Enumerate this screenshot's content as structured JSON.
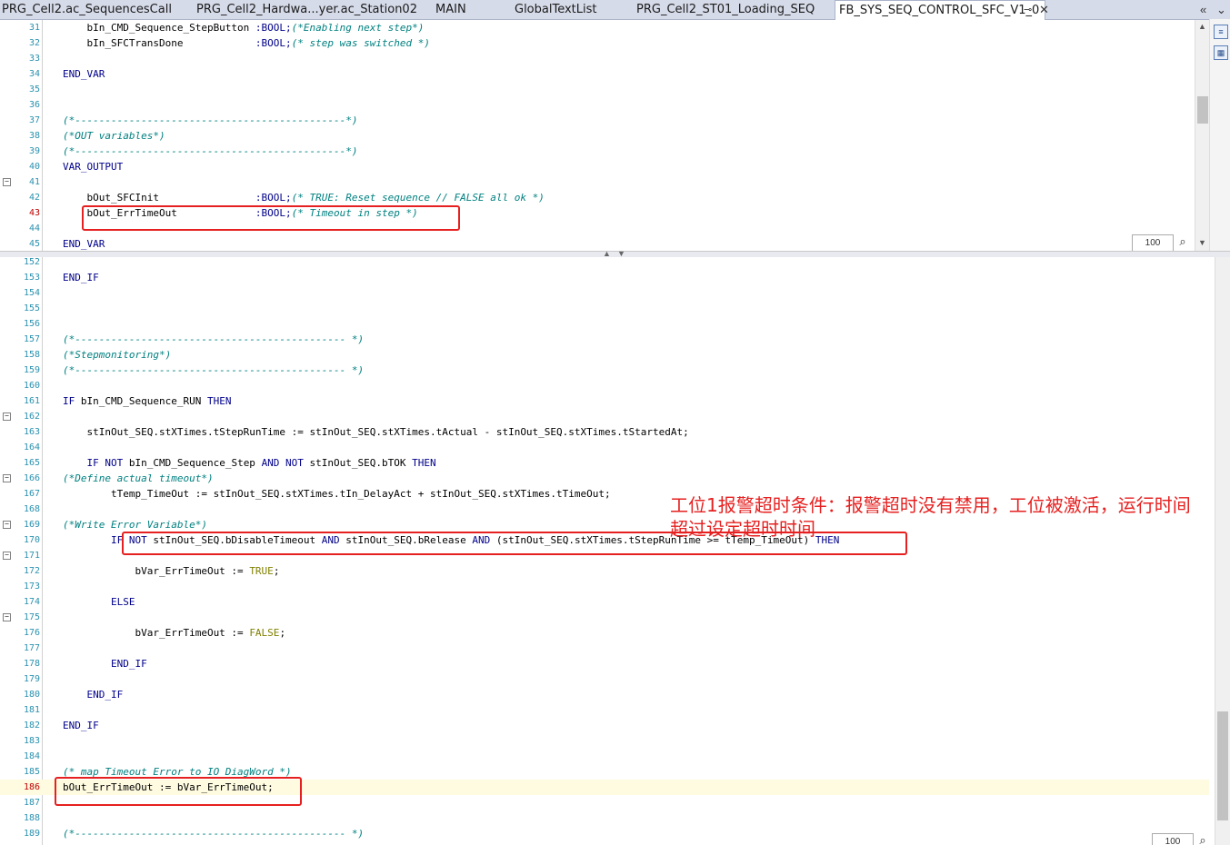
{
  "tabs": [
    {
      "label": "PRG_Cell2.ac_SequencesCall",
      "active": false
    },
    {
      "label": "PRG_Cell2_Hardwa...yer.ac_Station02",
      "active": false
    },
    {
      "label": "MAIN",
      "active": false
    },
    {
      "label": "GlobalTextList",
      "active": false
    },
    {
      "label": "PRG_Cell2_ST01_Loading_SEQ",
      "active": false
    },
    {
      "label": "FB_SYS_SEQ_CONTROL_SFC_V1_0",
      "active": true
    }
  ],
  "tab_controls": {
    "pin": "⊸",
    "close": "✕",
    "scroll_left": "«",
    "scroll_right": "⌄"
  },
  "top_pane": {
    "zoom": "100",
    "lines": [
      {
        "n": "31",
        "segs": [
          [
            "",
            "    bIn_CMD_Sequence_StepButton "
          ],
          [
            "kw",
            ":BOOL;"
          ],
          [
            "cm",
            "(*Enabling next step*)"
          ]
        ]
      },
      {
        "n": "32",
        "segs": [
          [
            "",
            "    bIn_SFCTransDone            "
          ],
          [
            "kw",
            ":BOOL;"
          ],
          [
            "cm",
            "(* step was switched *)"
          ]
        ]
      },
      {
        "n": "33",
        "segs": []
      },
      {
        "n": "34",
        "segs": [
          [
            "kw",
            "END_VAR"
          ]
        ]
      },
      {
        "n": "35",
        "segs": []
      },
      {
        "n": "36",
        "segs": []
      },
      {
        "n": "37",
        "segs": [
          [
            "cm",
            "(*---------------------------------------------*)"
          ]
        ]
      },
      {
        "n": "38",
        "segs": [
          [
            "cm",
            "(*OUT variables*)"
          ]
        ]
      },
      {
        "n": "39",
        "segs": [
          [
            "cm",
            "(*---------------------------------------------*)"
          ]
        ]
      },
      {
        "n": "40",
        "segs": [
          [
            "kw",
            "VAR_OUTPUT"
          ]
        ]
      },
      {
        "n": "41",
        "segs": [],
        "fold": true
      },
      {
        "n": "42",
        "segs": [
          [
            "",
            "    bOut_SFCInit                "
          ],
          [
            "kw",
            ":BOOL;"
          ],
          [
            "cm",
            "(* TRUE: Reset sequence // FALSE all ok *)"
          ]
        ]
      },
      {
        "n": "43",
        "segs": [
          [
            "",
            "    bOut_ErrTimeOut             "
          ],
          [
            "kw",
            ":BOOL;"
          ],
          [
            "cm",
            "(* Timeout in step *)"
          ]
        ],
        "cur": true
      },
      {
        "n": "44",
        "segs": []
      },
      {
        "n": "45",
        "segs": [
          [
            "kw",
            "END_VAR"
          ]
        ]
      }
    ]
  },
  "bottom_pane": {
    "zoom": "100",
    "lines": [
      {
        "n": "152",
        "segs": []
      },
      {
        "n": "153",
        "segs": [
          [
            "kw",
            "END_IF"
          ]
        ]
      },
      {
        "n": "154",
        "segs": []
      },
      {
        "n": "155",
        "segs": []
      },
      {
        "n": "156",
        "segs": []
      },
      {
        "n": "157",
        "segs": [
          [
            "cm",
            "(*--------------------------------------------- *)"
          ]
        ]
      },
      {
        "n": "158",
        "segs": [
          [
            "cm",
            "(*Stepmonitoring*)"
          ]
        ]
      },
      {
        "n": "159",
        "segs": [
          [
            "cm",
            "(*--------------------------------------------- *)"
          ]
        ]
      },
      {
        "n": "160",
        "segs": []
      },
      {
        "n": "161",
        "segs": [
          [
            "kw",
            "IF "
          ],
          [
            "",
            "bIn_CMD_Sequence_RUN "
          ],
          [
            "kw",
            "THEN"
          ]
        ]
      },
      {
        "n": "162",
        "segs": [],
        "fold": true
      },
      {
        "n": "163",
        "segs": [
          [
            "",
            "    stInOut_SEQ.stXTimes.tStepRunTime := stInOut_SEQ.stXTimes.tActual - stInOut_SEQ.stXTimes.tStartedAt;"
          ]
        ]
      },
      {
        "n": "164",
        "segs": []
      },
      {
        "n": "165",
        "segs": [
          [
            "kw",
            "    IF NOT "
          ],
          [
            "",
            "bIn_CMD_Sequence_Step "
          ],
          [
            "kw",
            "AND NOT "
          ],
          [
            "",
            "stInOut_SEQ.bTOK "
          ],
          [
            "kw",
            "THEN"
          ]
        ]
      },
      {
        "n": "166",
        "segs": [
          [
            "cm",
            "(*Define actual timeout*)"
          ]
        ],
        "fold": true
      },
      {
        "n": "167",
        "segs": [
          [
            "",
            "        tTemp_TimeOut := stInOut_SEQ.stXTimes.tIn_DelayAct + stInOut_SEQ.stXTimes.tTimeOut;"
          ]
        ]
      },
      {
        "n": "168",
        "segs": []
      },
      {
        "n": "169",
        "segs": [
          [
            "cm",
            "(*Write Error Variable*)"
          ]
        ],
        "fold": true
      },
      {
        "n": "170",
        "segs": [
          [
            "kw",
            "        IF NOT "
          ],
          [
            "",
            "stInOut_SEQ.bDisableTimeout "
          ],
          [
            "kw",
            "AND "
          ],
          [
            "",
            "stInOut_SEQ.bRelease "
          ],
          [
            "kw",
            "AND "
          ],
          [
            "",
            "(stInOut_SEQ.stXTimes.tStepRunTime >= tTemp_TimeOut) "
          ],
          [
            "kw",
            "THEN"
          ]
        ]
      },
      {
        "n": "171",
        "segs": [],
        "fold": true
      },
      {
        "n": "172",
        "segs": [
          [
            "",
            "            bVar_ErrTimeOut := "
          ],
          [
            "lit",
            "TRUE"
          ],
          [
            "",
            ";"
          ]
        ]
      },
      {
        "n": "173",
        "segs": []
      },
      {
        "n": "174",
        "segs": [
          [
            "kw",
            "        ELSE"
          ]
        ]
      },
      {
        "n": "175",
        "segs": [],
        "fold": true
      },
      {
        "n": "176",
        "segs": [
          [
            "",
            "            bVar_ErrTimeOut := "
          ],
          [
            "lit",
            "FALSE"
          ],
          [
            "",
            ";"
          ]
        ]
      },
      {
        "n": "177",
        "segs": []
      },
      {
        "n": "178",
        "segs": [
          [
            "kw",
            "        END_IF"
          ]
        ]
      },
      {
        "n": "179",
        "segs": []
      },
      {
        "n": "180",
        "segs": [
          [
            "kw",
            "    END_IF"
          ]
        ]
      },
      {
        "n": "181",
        "segs": []
      },
      {
        "n": "182",
        "segs": [
          [
            "kw",
            "END_IF"
          ]
        ]
      },
      {
        "n": "183",
        "segs": []
      },
      {
        "n": "184",
        "segs": []
      },
      {
        "n": "185",
        "segs": [
          [
            "cm",
            "(* map Timeout Error to IO DiagWord *)"
          ]
        ]
      },
      {
        "n": "186",
        "segs": [
          [
            "",
            "bOut_ErrTimeOut := bVar_ErrTimeOut;"
          ]
        ],
        "cur": true,
        "hl": true
      },
      {
        "n": "187",
        "segs": []
      },
      {
        "n": "188",
        "segs": []
      },
      {
        "n": "189",
        "segs": [
          [
            "cm",
            "(*--------------------------------------------- *)"
          ]
        ]
      }
    ]
  },
  "annotation": {
    "line1": "工位1报警超时条件：报警超时没有禁用，工位被激活，运行时间",
    "line2": "超过设定超时时间"
  }
}
